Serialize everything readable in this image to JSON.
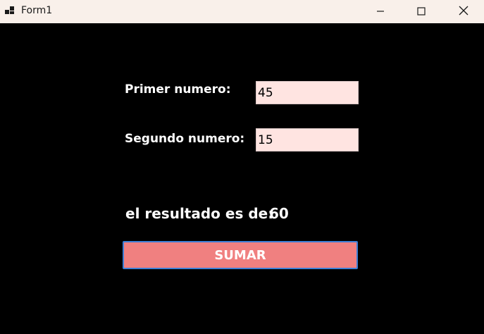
{
  "window": {
    "title": "Form1",
    "icon": "app-form-icon",
    "controls": [
      "minimize-icon",
      "maximize-icon",
      "close-icon"
    ],
    "titlebar_color": "#f9f0ea",
    "background_color": "#000000"
  },
  "form": {
    "primer_label": "Primer numero:",
    "primer_value": "45",
    "segundo_label": "Segundo numero:",
    "segundo_value": "15",
    "resultado_label": "el resultado es de:",
    "resultado_value": "60",
    "sumar_label": "SUMAR",
    "textbox_color": "#ffe4e1",
    "button_color": "#f08080"
  }
}
